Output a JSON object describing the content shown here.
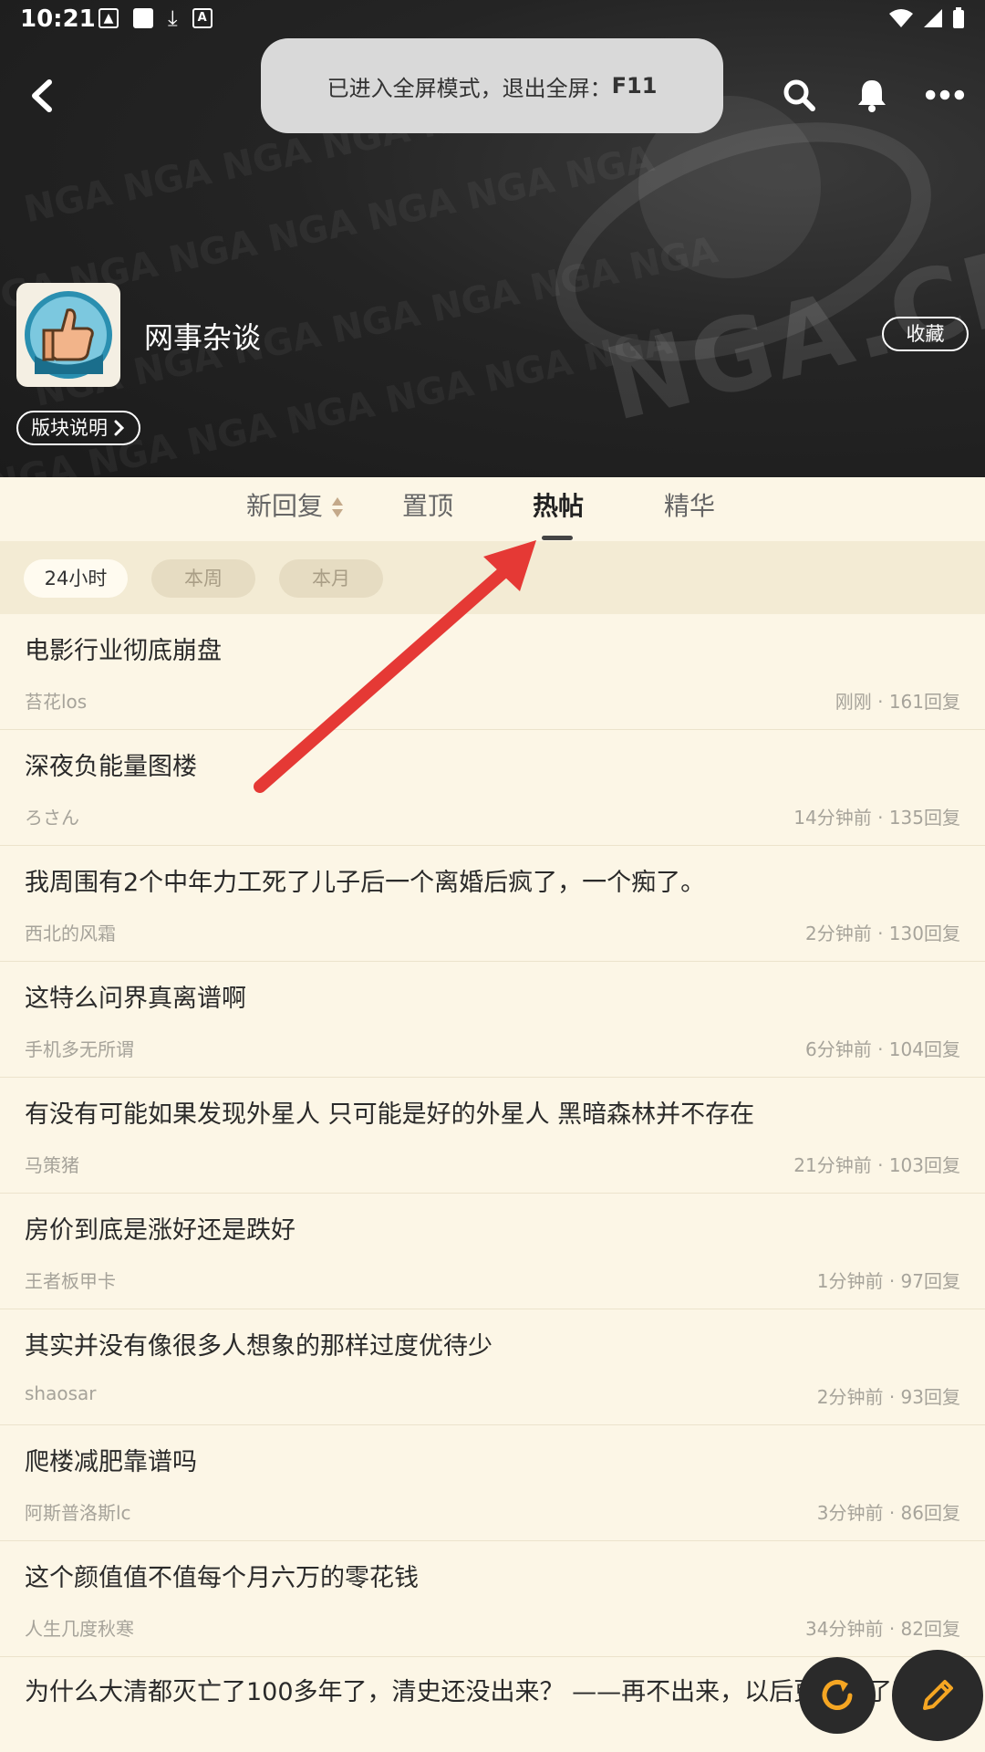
{
  "status_bar": {
    "time": "10:21"
  },
  "toast": {
    "text": "已进入全屏模式，退出全屏：",
    "key": "F11"
  },
  "forum": {
    "name": "网事杂谈",
    "favorite_label": "收藏",
    "description_label": "版块说明"
  },
  "tabs": [
    {
      "label": "新回复"
    },
    {
      "label": "置顶"
    },
    {
      "label": "热帖"
    },
    {
      "label": "精华"
    }
  ],
  "filters": [
    {
      "label": "24小时"
    },
    {
      "label": "本周"
    },
    {
      "label": "本月"
    }
  ],
  "posts": [
    {
      "title": "电影行业彻底崩盘",
      "author": "苔花los",
      "meta": "刚刚 · 161回复"
    },
    {
      "title": "深夜负能量图楼",
      "author": "ろさん",
      "meta": "14分钟前 · 135回复"
    },
    {
      "title": "我周围有2个中年力工死了儿子后一个离婚后疯了，一个痴了。",
      "author": "西北的风霜",
      "meta": "2分钟前 · 130回复"
    },
    {
      "title": "这特么问界真离谱啊",
      "author": "手机多无所谓",
      "meta": "6分钟前 · 104回复"
    },
    {
      "title": "有没有可能如果发现外星人  只可能是好的外星人 黑暗森林并不存在",
      "author": "马策猪",
      "meta": "21分钟前 · 103回复"
    },
    {
      "title": "房价到底是涨好还是跌好",
      "author": "王者板甲卡",
      "meta": "1分钟前 · 97回复"
    },
    {
      "title": "其实并没有像很多人想象的那样过度优待少",
      "author": "shaosar",
      "meta": "2分钟前 · 93回复"
    },
    {
      "title": "爬楼减肥靠谱吗",
      "author": "阿斯普洛斯lc",
      "meta": "3分钟前 · 86回复"
    },
    {
      "title": "这个颜值值不值每个月六万的零花钱",
      "author": "人生几度秋寒",
      "meta": "34分钟前 · 82回复"
    },
    {
      "title": "为什么大清都灭亡了100多年了，清史还没出来？  ——再不出来，以后更难出了吧"
    }
  ],
  "colors": {
    "accent_arrow": "#e53935",
    "background": "#fcf6e6",
    "header": "#1f1f1f"
  }
}
